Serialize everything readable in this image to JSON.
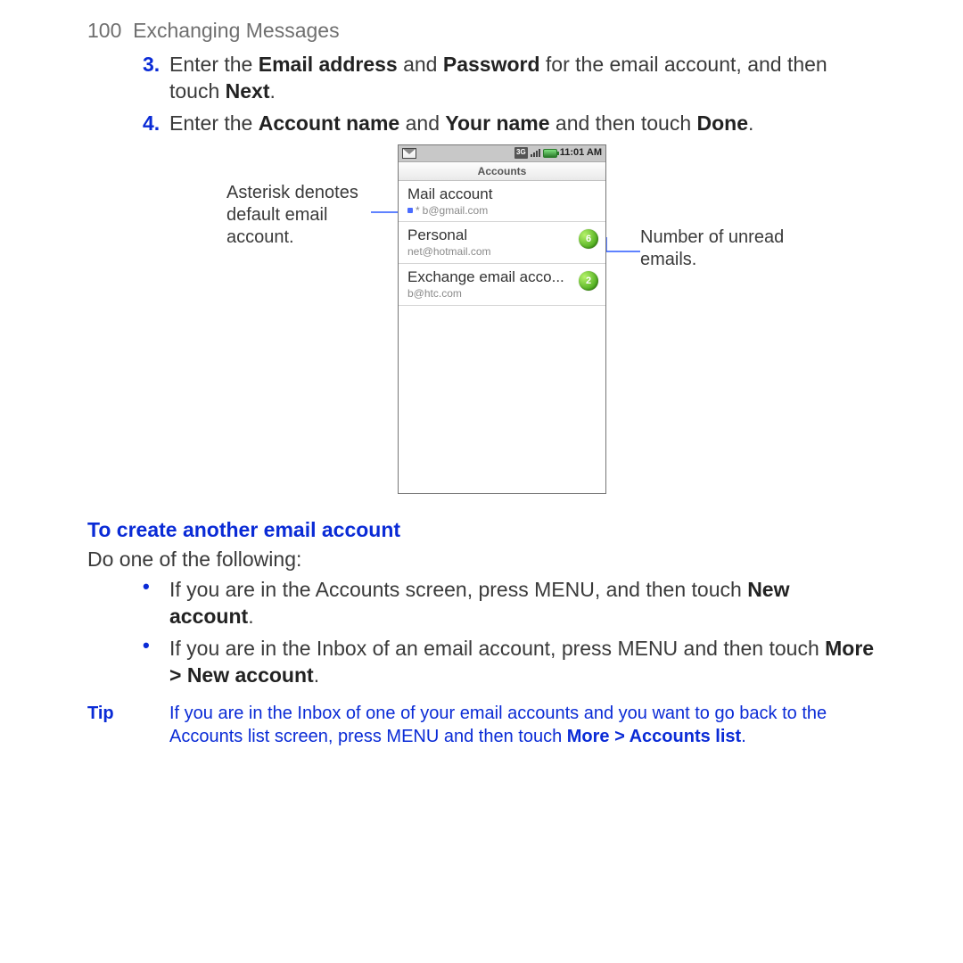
{
  "page": {
    "number": "100",
    "section": "Exchanging Messages"
  },
  "steps": {
    "s3_num": "3.",
    "s3_a": "Enter the ",
    "s3_b1": "Email address",
    "s3_c": " and ",
    "s3_b2": "Password",
    "s3_d": " for the email account, and then touch ",
    "s3_b3": "Next",
    "s3_e": ".",
    "s4_num": "4.",
    "s4_a": "Enter the ",
    "s4_b1": "Account name",
    "s4_c": " and ",
    "s4_b2": "Your name",
    "s4_d": " and then touch ",
    "s4_b3": "Done",
    "s4_e": "."
  },
  "callouts": {
    "left": "Asterisk denotes default email account.",
    "right": "Number of unread emails."
  },
  "device": {
    "time": "11:01 AM",
    "network": "3G",
    "title": "Accounts",
    "accounts": {
      "a0": {
        "name": "Mail account",
        "email": "b@gmail.com",
        "asterisk": "*"
      },
      "a1": {
        "name": "Personal",
        "email": "net@hotmail.com",
        "badge": "6"
      },
      "a2": {
        "name": "Exchange email acco...",
        "email": "b@htc.com",
        "badge": "2"
      }
    }
  },
  "heading2": "To create another email account",
  "heading2_sub": "Do one of the following:",
  "bullets": {
    "b1_a": "If you are in the Accounts screen, press MENU, and then touch ",
    "b1_b": "New account",
    "b1_c": ".",
    "b2_a": "If you are in the Inbox of an email account, press MENU and then touch ",
    "b2_b": "More > New account",
    "b2_c": "."
  },
  "tip": {
    "label": "Tip",
    "a": "If you are in the Inbox of one of your email accounts and you want to go back to the Accounts list screen, press MENU and then touch ",
    "b": "More > Accounts list",
    "c": "."
  }
}
